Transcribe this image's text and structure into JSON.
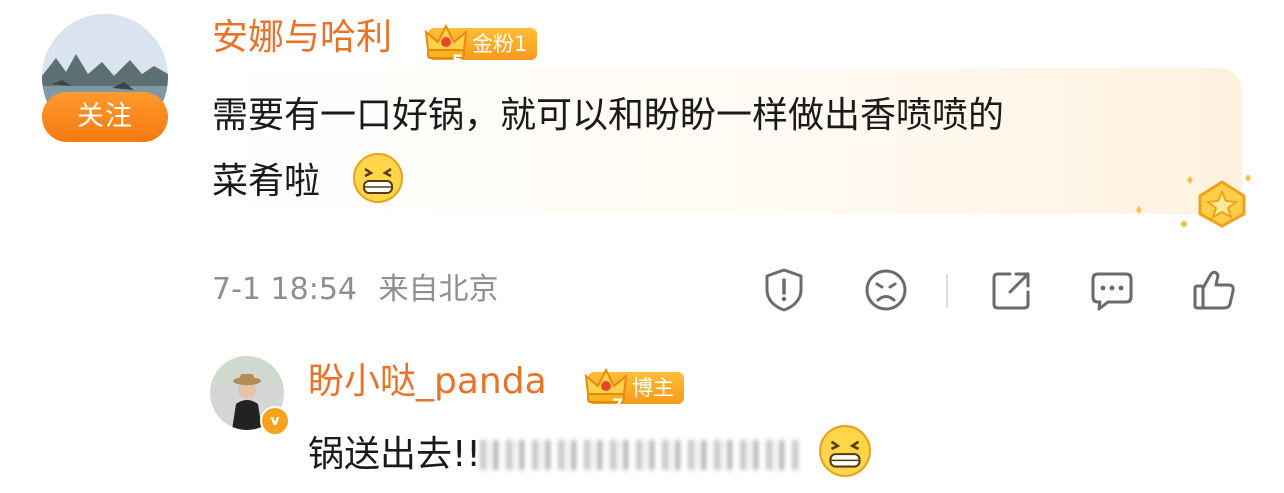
{
  "comment": {
    "username": "安娜与哈利",
    "badge": {
      "level": "5",
      "label": "金粉1"
    },
    "follow_label": "关注",
    "text_line1": "需要有一口好锅，就可以和盼盼一样做出香喷喷的",
    "text_line2": "菜肴啦",
    "timestamp": "7-1 18:54",
    "location": "来自北京"
  },
  "actions": [
    {
      "name": "report-icon"
    },
    {
      "name": "dislike-icon"
    },
    {
      "name": "share-icon"
    },
    {
      "name": "comment-icon"
    },
    {
      "name": "like-icon"
    }
  ],
  "reply": {
    "username": "盼小哒_panda",
    "badge": {
      "level": "7",
      "label": "博主"
    },
    "text_visible": "锅送出去!!"
  },
  "colors": {
    "accent": "#e8732a",
    "badge": "#f79a1a",
    "follow": "#f57a10"
  }
}
